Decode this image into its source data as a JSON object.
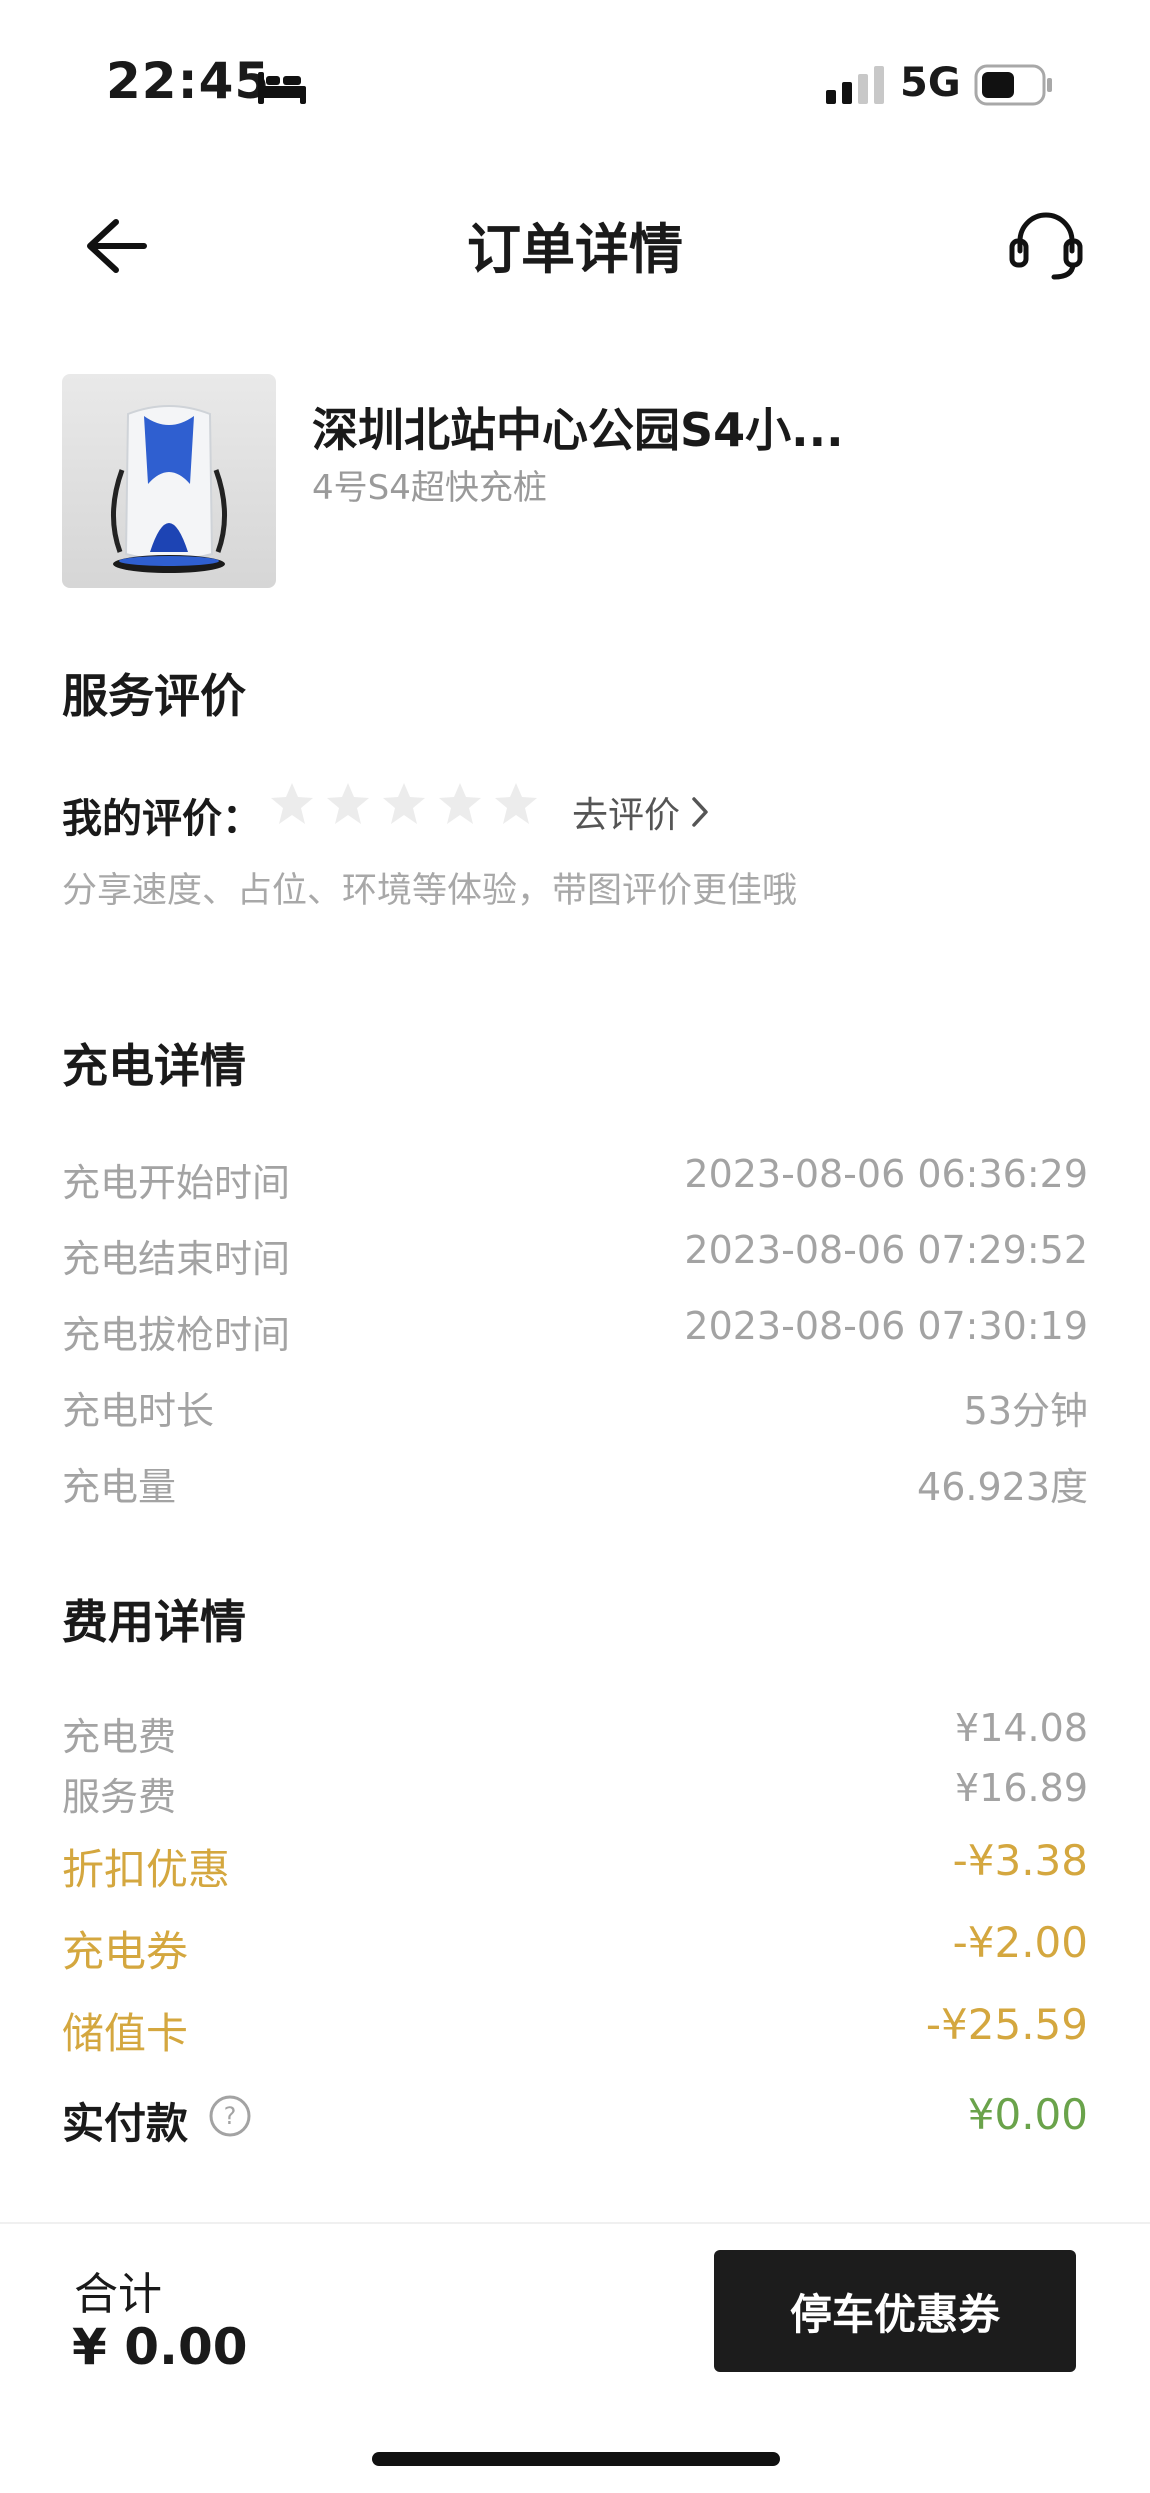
{
  "status_bar": {
    "time": "22:45",
    "network": "5G"
  },
  "header": {
    "title": "订单详情"
  },
  "station": {
    "name": "深圳北站中心公园S4小...",
    "sub": "4号S4超快充桩"
  },
  "service_review": {
    "title": "服务评价",
    "my_rating_label": "我的评价：",
    "rating": 0,
    "rating_max": 5,
    "go_review": "去评价",
    "hint": "分享速度、占位、环境等体验，带图评价更佳哦"
  },
  "charging": {
    "title": "充电详情",
    "rows": [
      {
        "label": "充电开始时间",
        "value": "2023-08-06 06:36:29"
      },
      {
        "label": "充电结束时间",
        "value": "2023-08-06 07:29:52"
      },
      {
        "label": "充电拔枪时间",
        "value": "2023-08-06 07:30:19"
      },
      {
        "label": "充电时长",
        "value": "53分钟"
      },
      {
        "label": "充电量",
        "value": "46.923度"
      }
    ]
  },
  "fees": {
    "title": "费用详情",
    "rows": [
      {
        "label": "充电费",
        "value": "¥14.08"
      },
      {
        "label": "服务费",
        "value": "¥16.89"
      }
    ],
    "discounts": [
      {
        "label": "折扣优惠",
        "value": "-¥3.38"
      },
      {
        "label": "充电券",
        "value": "-¥2.00"
      },
      {
        "label": "储值卡",
        "value": "-¥25.59"
      }
    ],
    "paid_label": "实付款",
    "paid_value": "¥0.00"
  },
  "bottom": {
    "total_label": "合计",
    "total_value": "¥ 0.00",
    "button_label": "停车优惠券"
  },
  "colors": {
    "accent_gold": "#d4a73f",
    "paid_green": "#6aa34b",
    "button_dark": "#1c1c1c"
  }
}
